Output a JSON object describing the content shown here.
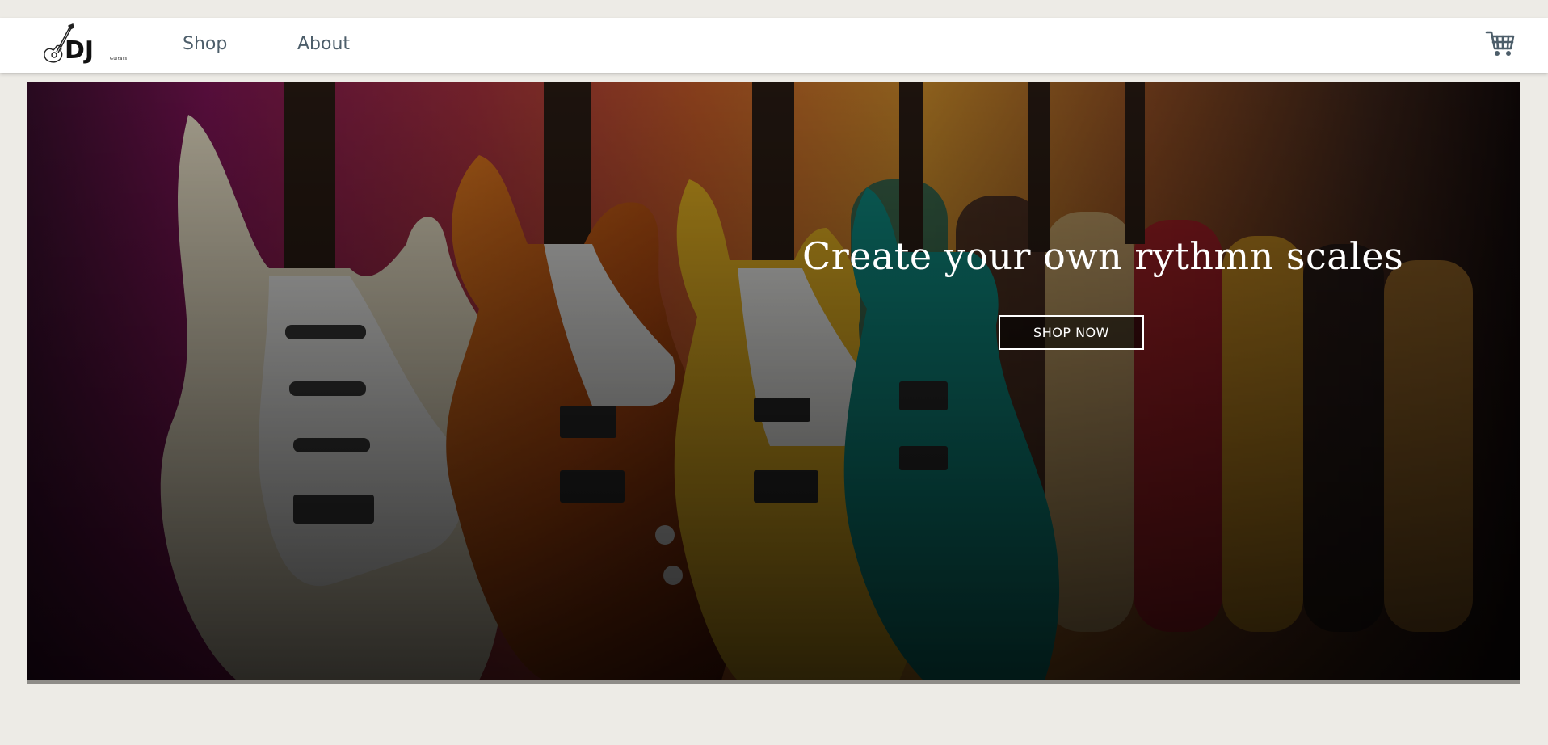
{
  "brand": {
    "logo_text": "DJ",
    "logo_subtext": "Guitars",
    "logo_icon": "guitar-icon"
  },
  "nav": {
    "links": [
      {
        "label": "Shop"
      },
      {
        "label": "About"
      }
    ],
    "cart_icon": "shopping-cart-icon"
  },
  "hero": {
    "title": "Create your own rythmn scales",
    "button_label": "SHOP NOW"
  },
  "colors": {
    "page_background": "#edebe6",
    "navbar_background": "#ffffff",
    "nav_text": "#4d5e6a",
    "cart_icon": "#4d5e6a",
    "hero_text": "#ffffff"
  }
}
